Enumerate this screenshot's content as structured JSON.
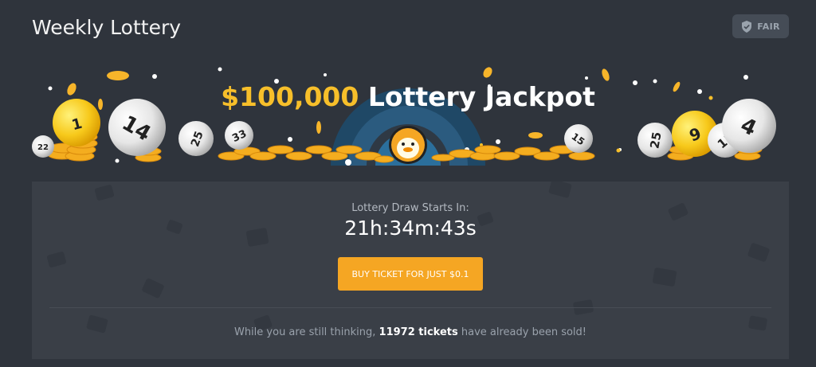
{
  "page": {
    "title": "Weekly Lottery"
  },
  "fair_button": {
    "label": "FAIR",
    "icon": "shield-check-icon"
  },
  "banner": {
    "amount": "$100,000",
    "title": "Lottery Jackpot",
    "balls": [
      "22",
      "1",
      "14",
      "25",
      "33",
      "15",
      "25",
      "9",
      "11",
      "4"
    ],
    "mascot": "duck-icon"
  },
  "draw": {
    "label": "Lottery Draw Starts In:",
    "countdown": "21h:34m:43s"
  },
  "buy_button": {
    "label": "BUY TICKET FOR JUST $0.1"
  },
  "sold": {
    "prefix": "While you are still thinking,",
    "count": "11972 tickets",
    "suffix": "have already been sold!"
  },
  "colors": {
    "background": "#2f343c",
    "panel": "#3a3f47",
    "accent_gold": "#f7bf2a",
    "button": "#f5a623",
    "glow": "#2b6f9c"
  }
}
